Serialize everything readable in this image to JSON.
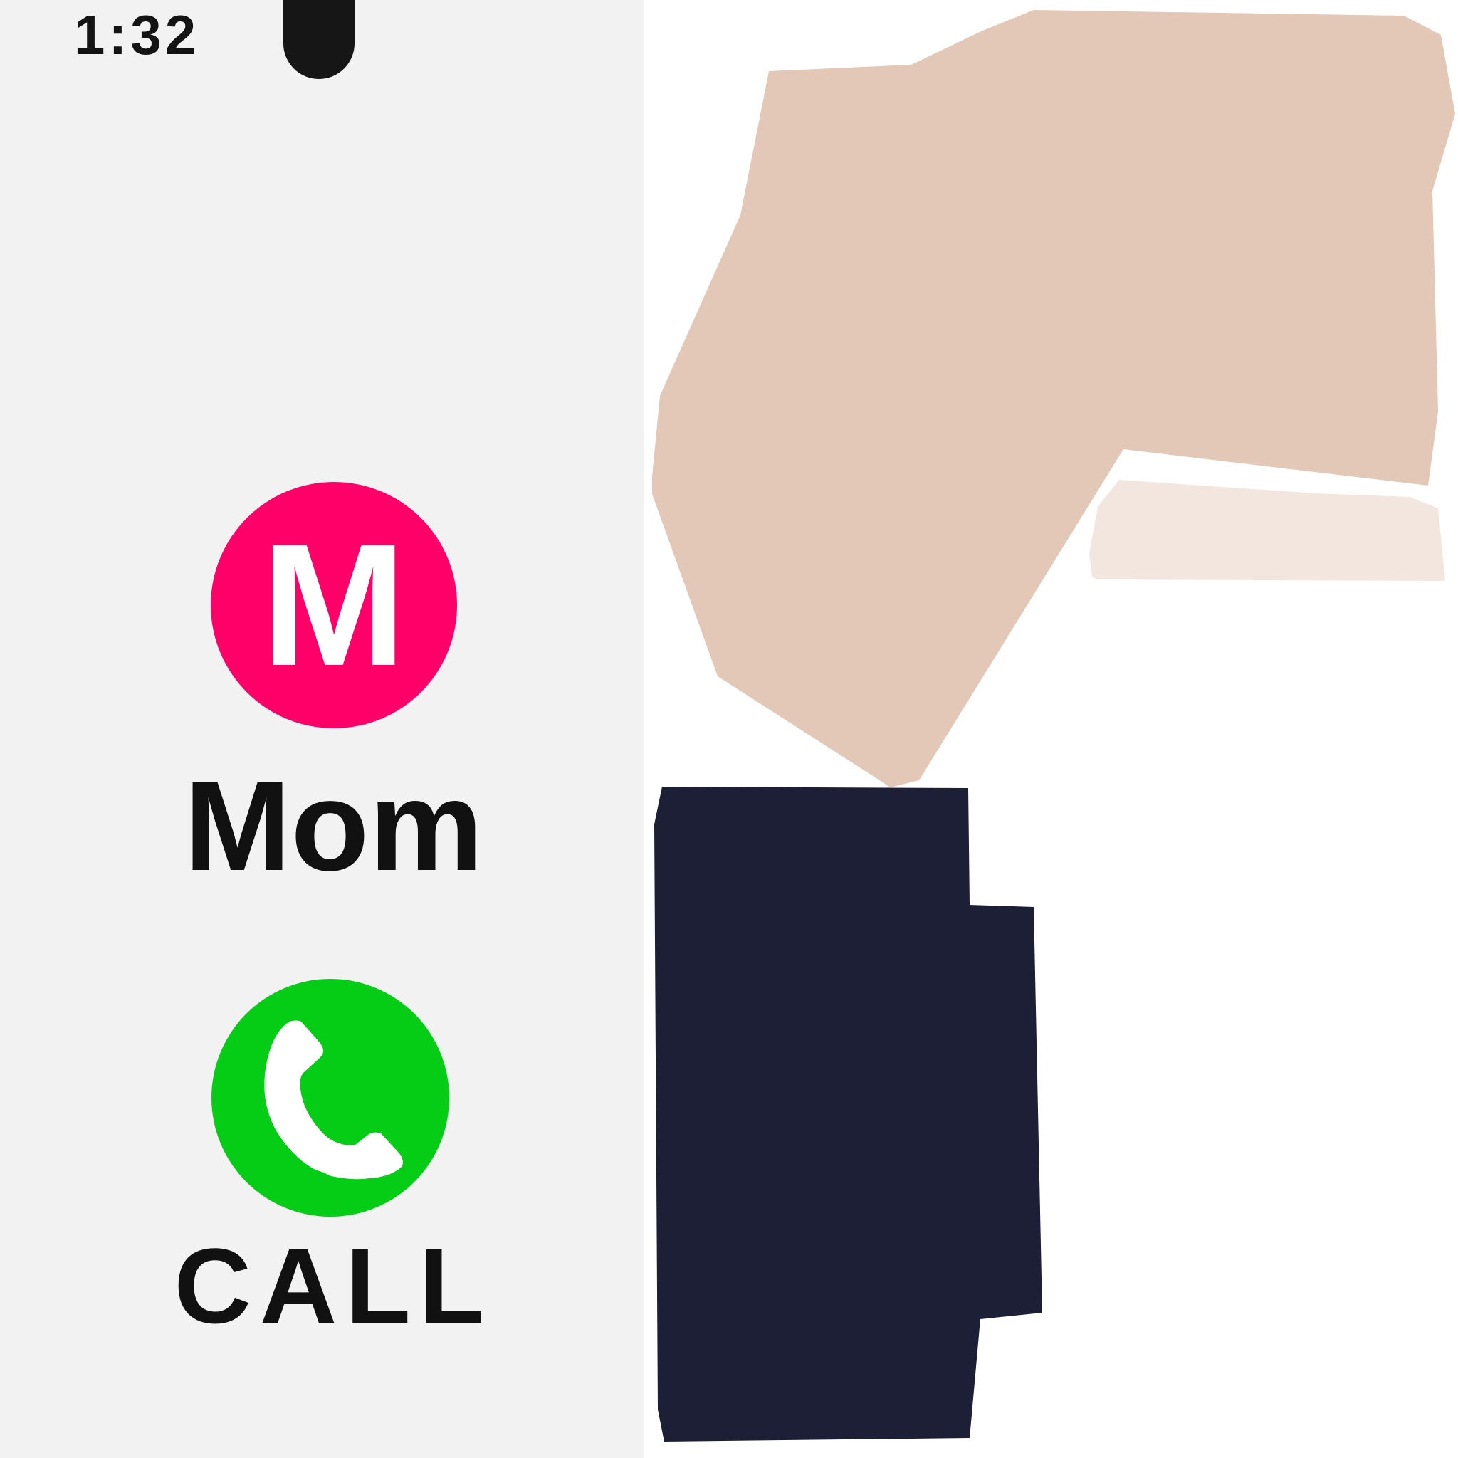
{
  "status_bar": {
    "time": "1:32"
  },
  "contact": {
    "initial": "M",
    "name": "Mom",
    "avatar_color": "#ff0068"
  },
  "call_action": {
    "label": "CALL",
    "button_color": "#05cc14",
    "icon": "phone-handset-icon"
  },
  "person": {
    "arm_color": "#e3c8b8",
    "sleeve_color": "#f2e6de",
    "pants_color": "#1c1f35"
  }
}
